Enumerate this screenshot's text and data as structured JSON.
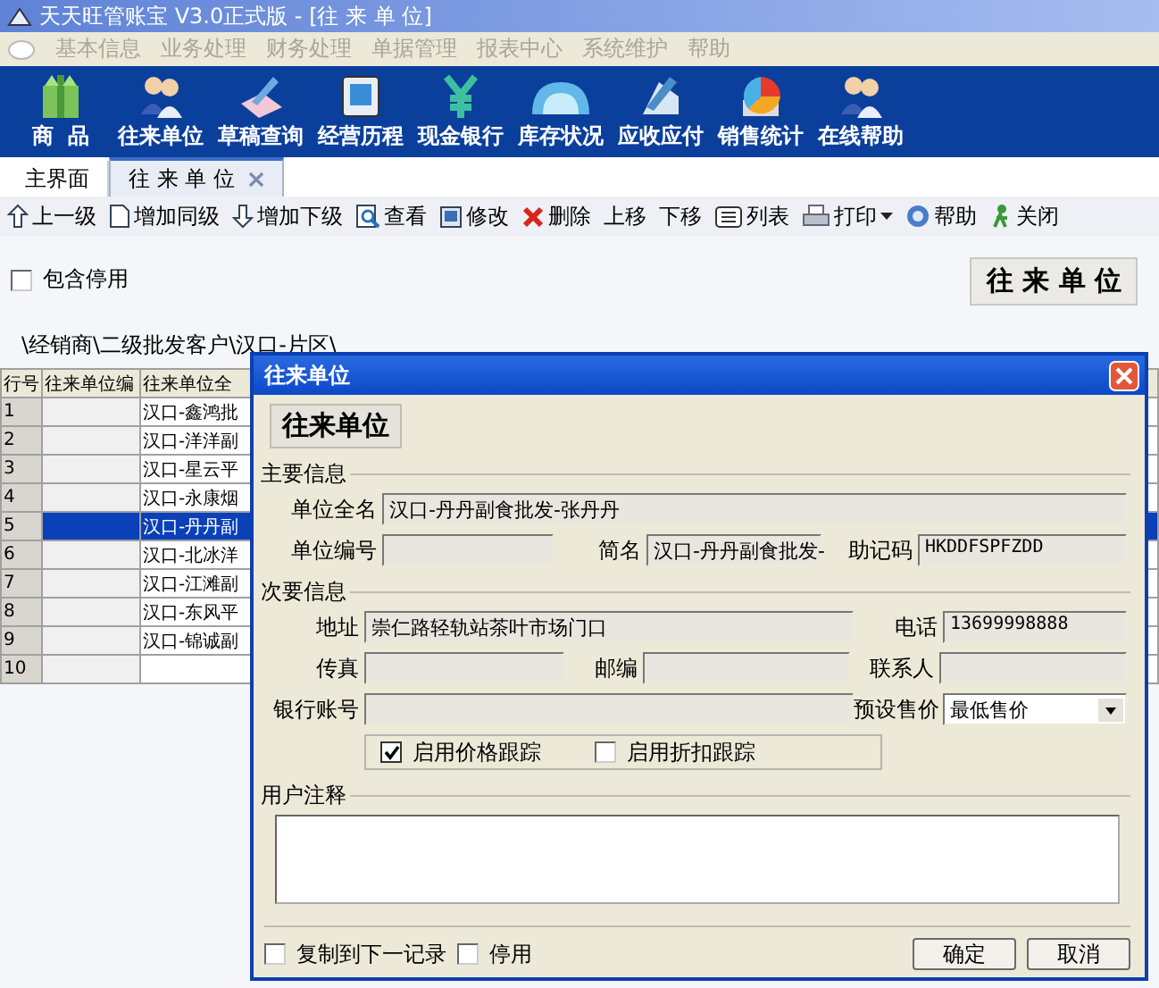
{
  "window": {
    "title": "天天旺管账宝 V3.0正式版 - [往 来 单 位]"
  },
  "menu": [
    {
      "label": "基本信息",
      "disabled": true
    },
    {
      "label": "业务处理",
      "disabled": true
    },
    {
      "label": "财务处理",
      "disabled": true
    },
    {
      "label": "单据管理",
      "disabled": true
    },
    {
      "label": "报表中心",
      "disabled": true
    },
    {
      "label": "系统维护",
      "disabled": true
    },
    {
      "label": "帮助",
      "disabled": true
    }
  ],
  "main_toolbar": [
    {
      "label": "商  品"
    },
    {
      "label": "往来单位"
    },
    {
      "label": "草稿查询"
    },
    {
      "label": "经营历程"
    },
    {
      "label": "现金银行"
    },
    {
      "label": "库存状况"
    },
    {
      "label": "应收应付"
    },
    {
      "label": "销售统计"
    },
    {
      "label": "在线帮助"
    }
  ],
  "tabs": [
    {
      "label": "主界面",
      "selected": false,
      "closable": false
    },
    {
      "label": "往 来 单 位",
      "selected": true,
      "closable": true
    }
  ],
  "actions": [
    {
      "label": "上一级",
      "dropdown": false
    },
    {
      "label": "增加同级",
      "dropdown": false
    },
    {
      "label": "增加下级",
      "dropdown": false
    },
    {
      "label": "查看",
      "dropdown": false
    },
    {
      "label": "修改",
      "dropdown": false
    },
    {
      "label": "删除",
      "dropdown": false
    },
    {
      "label": "上移",
      "dropdown": false
    },
    {
      "label": "下移",
      "dropdown": false
    },
    {
      "label": "列表",
      "dropdown": false
    },
    {
      "label": "打印",
      "dropdown": true
    },
    {
      "label": "帮助",
      "dropdown": false
    },
    {
      "label": "关闭",
      "dropdown": false
    }
  ],
  "include_disabled": {
    "label": "包含停用",
    "checked": false
  },
  "heading": "往 来 单 位",
  "path": "\\经销商\\二级批发客户\\汉口-片区\\",
  "table": {
    "columns": [
      "行号",
      "往来单位编",
      "往来单位全"
    ],
    "rows": [
      {
        "no": "1",
        "name": "汉口-鑫鸿批",
        "selected": false
      },
      {
        "no": "2",
        "name": "汉口-洋洋副",
        "selected": false
      },
      {
        "no": "3",
        "name": "汉口-星云平",
        "selected": false
      },
      {
        "no": "4",
        "name": "汉口-永康烟",
        "selected": false
      },
      {
        "no": "5",
        "name": "汉口-丹丹副",
        "selected": true
      },
      {
        "no": "6",
        "name": "汉口-北冰洋",
        "selected": false
      },
      {
        "no": "7",
        "name": "汉口-江滩副",
        "selected": false
      },
      {
        "no": "8",
        "name": "汉口-东风平",
        "selected": false
      },
      {
        "no": "9",
        "name": "汉口-锦诚副",
        "selected": false
      },
      {
        "no": "10",
        "selected": false
      }
    ]
  },
  "dialog": {
    "title": "往来单位",
    "heading": "往来单位",
    "main_group": "主要信息",
    "full_name": {
      "label": "单位全名",
      "value": "汉口-丹丹副食批发-张丹丹"
    },
    "code": {
      "label": "单位编号"
    },
    "short_name": {
      "label": "简名",
      "value": "汉口-丹丹副食批发-"
    },
    "mnemonic": {
      "label": "助记码",
      "value": "HKDDFSPFZDD"
    },
    "secondary_group": "次要信息",
    "address": {
      "label": "地址",
      "value": "崇仁路轻轨站茶叶市场门口"
    },
    "phone": {
      "label": "电话",
      "value": "13699998888"
    },
    "fax": {
      "label": "传真"
    },
    "postcode": {
      "label": "邮编"
    },
    "contact": {
      "label": "联系人"
    },
    "bank_account": {
      "label": "银行账号"
    },
    "preset_price": {
      "label": "预设售价",
      "value": "最低售价"
    },
    "tracking": [
      {
        "label": "启用价格跟踪",
        "checked": true
      },
      {
        "label": "启用折扣跟踪",
        "checked": false
      }
    ],
    "notes_group": "用户注释",
    "footer_options": [
      {
        "label": "复制到下一记录",
        "checked": false
      },
      {
        "label": "停用",
        "checked": false
      }
    ],
    "buttons": [
      "确定",
      "取消"
    ]
  }
}
